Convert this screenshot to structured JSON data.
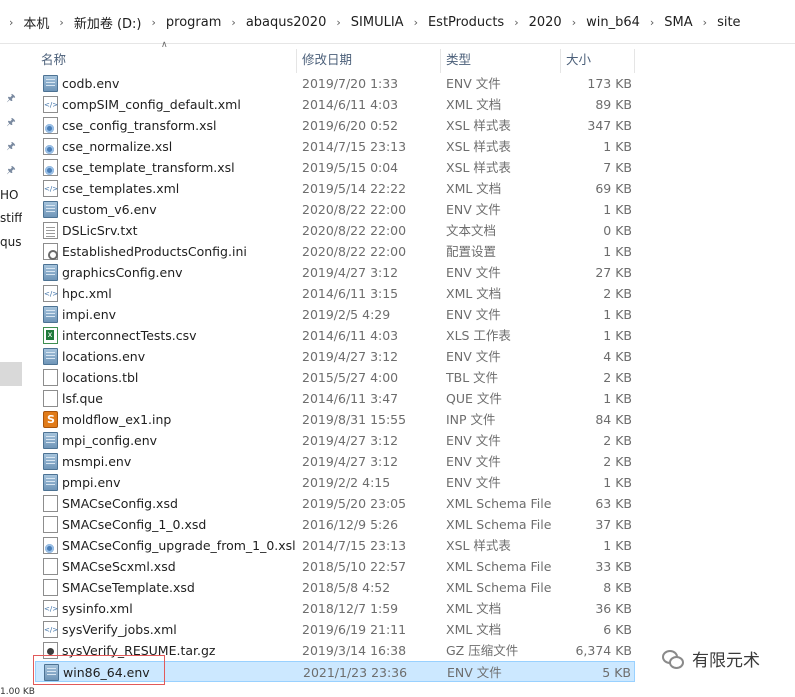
{
  "breadcrumb": [
    "本机",
    "新加卷 (D:)",
    "program",
    "abaqus2020",
    "SIMULIA",
    "EstProducts",
    "2020",
    "win_b64",
    "SMA",
    "site"
  ],
  "nav": {
    "fragments": [
      "HO",
      "stiff",
      "qus"
    ]
  },
  "columns": {
    "name": "名称",
    "date": "修改日期",
    "type": "类型",
    "size": "大小"
  },
  "files": [
    {
      "name": "codb.env",
      "date": "2019/7/20 1:33",
      "type": "ENV 文件",
      "size": "173 KB",
      "icon": "env-file-icon"
    },
    {
      "name": "compSIM_config_default.xml",
      "date": "2014/6/11 4:03",
      "type": "XML 文档",
      "size": "89 KB",
      "icon": "xml-file-icon"
    },
    {
      "name": "cse_config_transform.xsl",
      "date": "2019/6/20 0:52",
      "type": "XSL 样式表",
      "size": "347 KB",
      "icon": "xsl-file-icon"
    },
    {
      "name": "cse_normalize.xsl",
      "date": "2014/7/15 23:13",
      "type": "XSL 样式表",
      "size": "1 KB",
      "icon": "xsl-file-icon"
    },
    {
      "name": "cse_template_transform.xsl",
      "date": "2019/5/15 0:04",
      "type": "XSL 样式表",
      "size": "7 KB",
      "icon": "xsl-file-icon"
    },
    {
      "name": "cse_templates.xml",
      "date": "2019/5/14 22:22",
      "type": "XML 文档",
      "size": "69 KB",
      "icon": "xml-file-icon"
    },
    {
      "name": "custom_v6.env",
      "date": "2020/8/22 22:00",
      "type": "ENV 文件",
      "size": "1 KB",
      "icon": "env-file-icon"
    },
    {
      "name": "DSLicSrv.txt",
      "date": "2020/8/22 22:00",
      "type": "文本文档",
      "size": "0 KB",
      "icon": "text-file-icon"
    },
    {
      "name": "EstablishedProductsConfig.ini",
      "date": "2020/8/22 22:00",
      "type": "配置设置",
      "size": "1 KB",
      "icon": "ini-file-icon"
    },
    {
      "name": "graphicsConfig.env",
      "date": "2019/4/27 3:12",
      "type": "ENV 文件",
      "size": "27 KB",
      "icon": "env-file-icon"
    },
    {
      "name": "hpc.xml",
      "date": "2014/6/11 3:15",
      "type": "XML 文档",
      "size": "2 KB",
      "icon": "xml-file-icon"
    },
    {
      "name": "impi.env",
      "date": "2019/2/5 4:29",
      "type": "ENV 文件",
      "size": "1 KB",
      "icon": "env-file-icon"
    },
    {
      "name": "interconnectTests.csv",
      "date": "2014/6/11 4:03",
      "type": "XLS 工作表",
      "size": "1 KB",
      "icon": "csv-file-icon"
    },
    {
      "name": "locations.env",
      "date": "2019/4/27 3:12",
      "type": "ENV 文件",
      "size": "4 KB",
      "icon": "env-file-icon"
    },
    {
      "name": "locations.tbl",
      "date": "2015/5/27 4:00",
      "type": "TBL 文件",
      "size": "2 KB",
      "icon": "blank-file-icon"
    },
    {
      "name": "lsf.que",
      "date": "2014/6/11 3:47",
      "type": "QUE 文件",
      "size": "1 KB",
      "icon": "blank-file-icon"
    },
    {
      "name": "moldflow_ex1.inp",
      "date": "2019/8/31 15:55",
      "type": "INP 文件",
      "size": "84 KB",
      "icon": "inp-file-icon"
    },
    {
      "name": "mpi_config.env",
      "date": "2019/4/27 3:12",
      "type": "ENV 文件",
      "size": "2 KB",
      "icon": "env-file-icon"
    },
    {
      "name": "msmpi.env",
      "date": "2019/4/27 3:12",
      "type": "ENV 文件",
      "size": "2 KB",
      "icon": "env-file-icon"
    },
    {
      "name": "pmpi.env",
      "date": "2019/2/2 4:15",
      "type": "ENV 文件",
      "size": "1 KB",
      "icon": "env-file-icon"
    },
    {
      "name": "SMACseConfig.xsd",
      "date": "2019/5/20 23:05",
      "type": "XML Schema File",
      "size": "63 KB",
      "icon": "blank-file-icon"
    },
    {
      "name": "SMACseConfig_1_0.xsd",
      "date": "2016/12/9 5:26",
      "type": "XML Schema File",
      "size": "37 KB",
      "icon": "blank-file-icon"
    },
    {
      "name": "SMACseConfig_upgrade_from_1_0.xsl",
      "date": "2014/7/15 23:13",
      "type": "XSL 样式表",
      "size": "1 KB",
      "icon": "xsl-file-icon"
    },
    {
      "name": "SMACseScxml.xsd",
      "date": "2018/5/10 22:57",
      "type": "XML Schema File",
      "size": "33 KB",
      "icon": "blank-file-icon"
    },
    {
      "name": "SMACseTemplate.xsd",
      "date": "2018/5/8 4:52",
      "type": "XML Schema File",
      "size": "8 KB",
      "icon": "blank-file-icon"
    },
    {
      "name": "sysinfo.xml",
      "date": "2018/12/7 1:59",
      "type": "XML 文档",
      "size": "36 KB",
      "icon": "xml-file-icon"
    },
    {
      "name": "sysVerify_jobs.xml",
      "date": "2019/6/19 21:11",
      "type": "XML 文档",
      "size": "6 KB",
      "icon": "xml-file-icon"
    },
    {
      "name": "sysVerify_RESUME.tar.gz",
      "date": "2019/3/14 16:38",
      "type": "GZ 压缩文件",
      "size": "6,374 KB",
      "icon": "archive-file-icon"
    },
    {
      "name": "win86_64.env",
      "date": "2021/1/23 23:36",
      "type": "ENV 文件",
      "size": "5 KB",
      "icon": "env-file-icon",
      "selected": true
    }
  ],
  "watermark": "有限元术",
  "status": "1.00 KB",
  "colors": {
    "selection_bg": "#cce8ff",
    "selection_border": "#99d1ff",
    "highlight_box": "#e15a5a",
    "header_text": "#4c607a"
  }
}
